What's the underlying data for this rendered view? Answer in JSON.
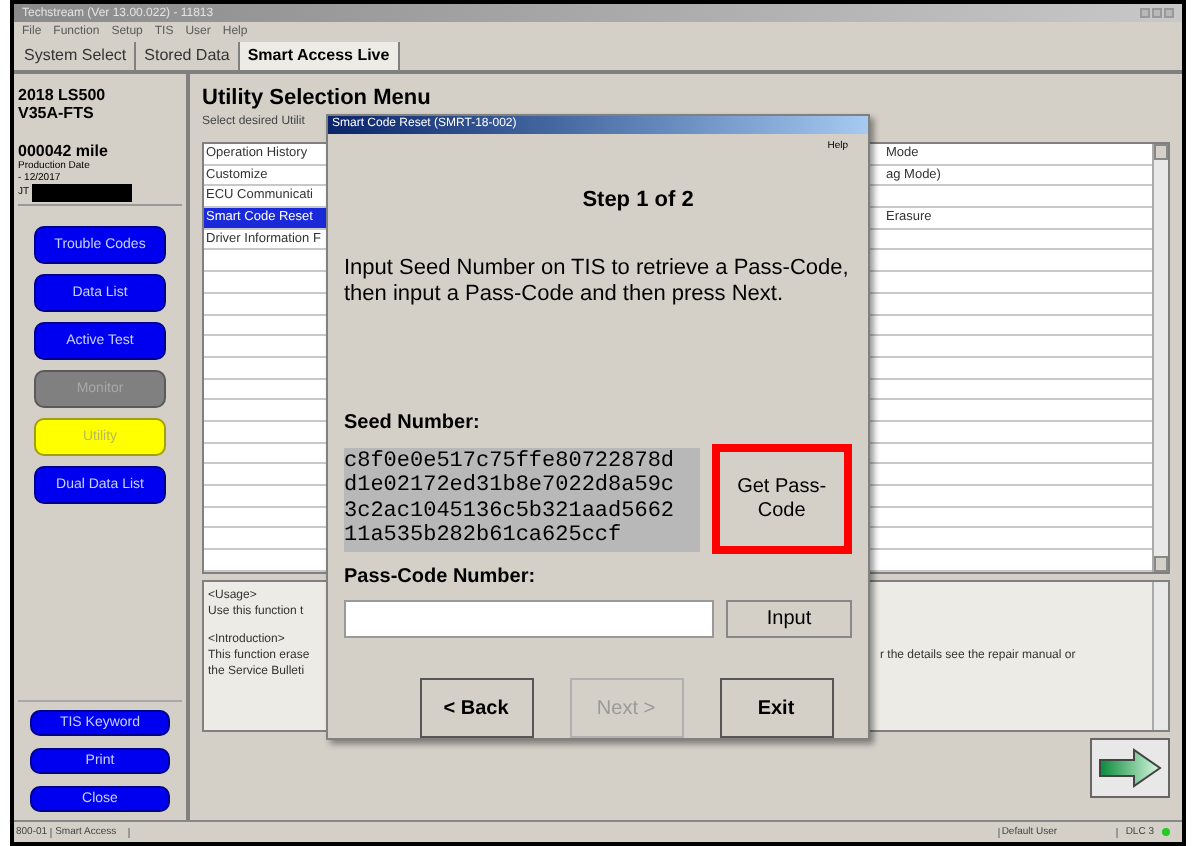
{
  "window": {
    "title": "Techstream (Ver 13.00.022) - 11813"
  },
  "menu": [
    "File",
    "Function",
    "Setup",
    "TIS",
    "User",
    "Help"
  ],
  "tabs": [
    {
      "label": "System Select",
      "selected": false
    },
    {
      "label": "Stored Data",
      "selected": false
    },
    {
      "label": "Smart Access Live",
      "selected": true
    }
  ],
  "vehicle": {
    "model": "2018 LS500",
    "engine": "V35A-FTS",
    "mileage": "000042 mile",
    "production_label": "Production Date",
    "production_date": "- 12/2017",
    "vin_prefix": "JT"
  },
  "sidebar": [
    {
      "label": "Trouble Codes",
      "selected": false,
      "disabled": false
    },
    {
      "label": "Data List",
      "selected": false,
      "disabled": false
    },
    {
      "label": "Active Test",
      "selected": false,
      "disabled": false
    },
    {
      "label": "Monitor",
      "selected": false,
      "disabled": true
    },
    {
      "label": "Utility",
      "selected": true,
      "disabled": false
    },
    {
      "label": "Dual Data List",
      "selected": false,
      "disabled": false
    }
  ],
  "sidebar_bottom": [
    "TIS Keyword",
    "Print",
    "Close"
  ],
  "main": {
    "title": "Utility Selection Menu",
    "subtitle": "Select desired Utilit"
  },
  "list": {
    "rows": [
      {
        "column_1": "Operation History",
        "column_2": "Mode",
        "selected": false
      },
      {
        "column_1": "Customize",
        "column_2": "ag Mode)",
        "selected": false
      },
      {
        "column_1": "ECU Communicati",
        "selected": false
      },
      {
        "column_1": "Smart Code Reset",
        "column_2": "Erasure",
        "selected": true
      },
      {
        "column_1": "Driver Information F",
        "selected": false
      }
    ]
  },
  "description": {
    "blocks": [
      [
        {
          "left": "<Usage>"
        },
        {
          "left": "Use this function t"
        }
      ],
      [
        {
          "left": "<Introduction>"
        },
        {
          "left": "This function erase",
          "right": "r the details see the repair manual or"
        },
        {
          "left": "the Service Bulleti"
        }
      ]
    ]
  },
  "dialog": {
    "title": "Smart Code Reset (SMRT-18-002)",
    "help": "Help",
    "step": "Step 1 of 2",
    "instruction": "Input Seed Number on TIS to retrieve a Pass-Code, then input a Pass-Code and then press Next.",
    "seed_label": "Seed Number:",
    "seed_lines": [
      "c8f0e0e517c75ffe80722878d",
      "d1e02172ed31b8e7022d8a59c",
      "3c2ac1045136c5b321aad5662",
      "11a535b282b61ca625ccf"
    ],
    "get_button": {
      "label": "Get Pass-Code",
      "highlighted": true
    },
    "pass_label": "Pass-Code Number:",
    "input_button": "Input",
    "buttons": [
      {
        "label": "< Back",
        "disabled": false
      },
      {
        "label": "Next >",
        "disabled": true
      },
      {
        "label": "Exit",
        "disabled": false
      }
    ]
  },
  "status_bar": {
    "code": "800-01",
    "mode": "Smart Access",
    "user": "Default User",
    "port": "DLC 3"
  }
}
